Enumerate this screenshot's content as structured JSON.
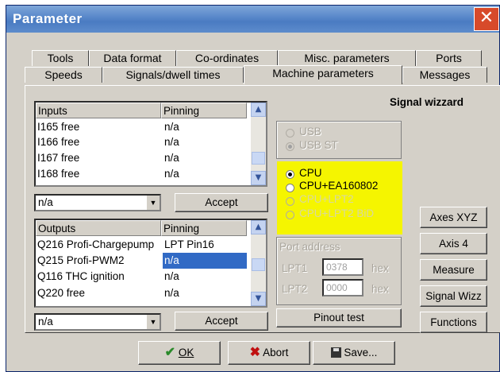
{
  "window": {
    "title": "Parameter",
    "close_glyph": "✕"
  },
  "tabs": {
    "row1": [
      "Tools",
      "Data format",
      "Co-ordinates",
      "Misc. parameters",
      "Ports"
    ],
    "row2": [
      "Speeds",
      "Signals/dwell times",
      "Machine parameters",
      "Messages"
    ]
  },
  "wizard_heading": "Signal wizzard",
  "inputs": {
    "headers": [
      "Inputs",
      "Pinning"
    ],
    "rows": [
      [
        "I165 free",
        "n/a"
      ],
      [
        "I166 free",
        "n/a"
      ],
      [
        "I167 free",
        "n/a"
      ],
      [
        "I168 free",
        "n/a"
      ]
    ],
    "combo_value": "n/a",
    "accept_label": "Accept"
  },
  "outputs": {
    "headers": [
      "Outputs",
      "Pinning"
    ],
    "rows": [
      [
        "Q216 Profi-Chargepump",
        "LPT Pin16"
      ],
      [
        "Q215 Profi-PWM2",
        "n/a"
      ],
      [
        "Q116 THC ignition",
        "n/a"
      ],
      [
        "Q220 free",
        "n/a"
      ]
    ],
    "selected_index": 1,
    "combo_value": "n/a",
    "accept_label": "Accept"
  },
  "usb_group": {
    "options": [
      "USB",
      "USB ST"
    ],
    "selected": "USB ST"
  },
  "cpu_group": {
    "options": [
      "CPU",
      "CPU+EA160802",
      "CPU+LPT2",
      "CPU+LPT2 BiD"
    ],
    "selected": "CPU",
    "highlight_color": "#f5f500"
  },
  "port_address": {
    "label": "Port address",
    "lpt1_label": "LPT1",
    "lpt1_value": "0378",
    "lpt2_label": "LPT2",
    "lpt2_value": "0000",
    "unit": "hex"
  },
  "pinout_test_label": "Pinout test",
  "side_buttons": [
    "Axes XYZ",
    "Axis 4",
    "Measure",
    "Signal Wizz",
    "Functions"
  ],
  "footer": {
    "ok_label": "OK",
    "ok_icon": "checkmark-icon",
    "abort_label": "Abort",
    "abort_icon": "x-icon",
    "save_label": "Save...",
    "save_icon": "floppy-disk-icon"
  }
}
